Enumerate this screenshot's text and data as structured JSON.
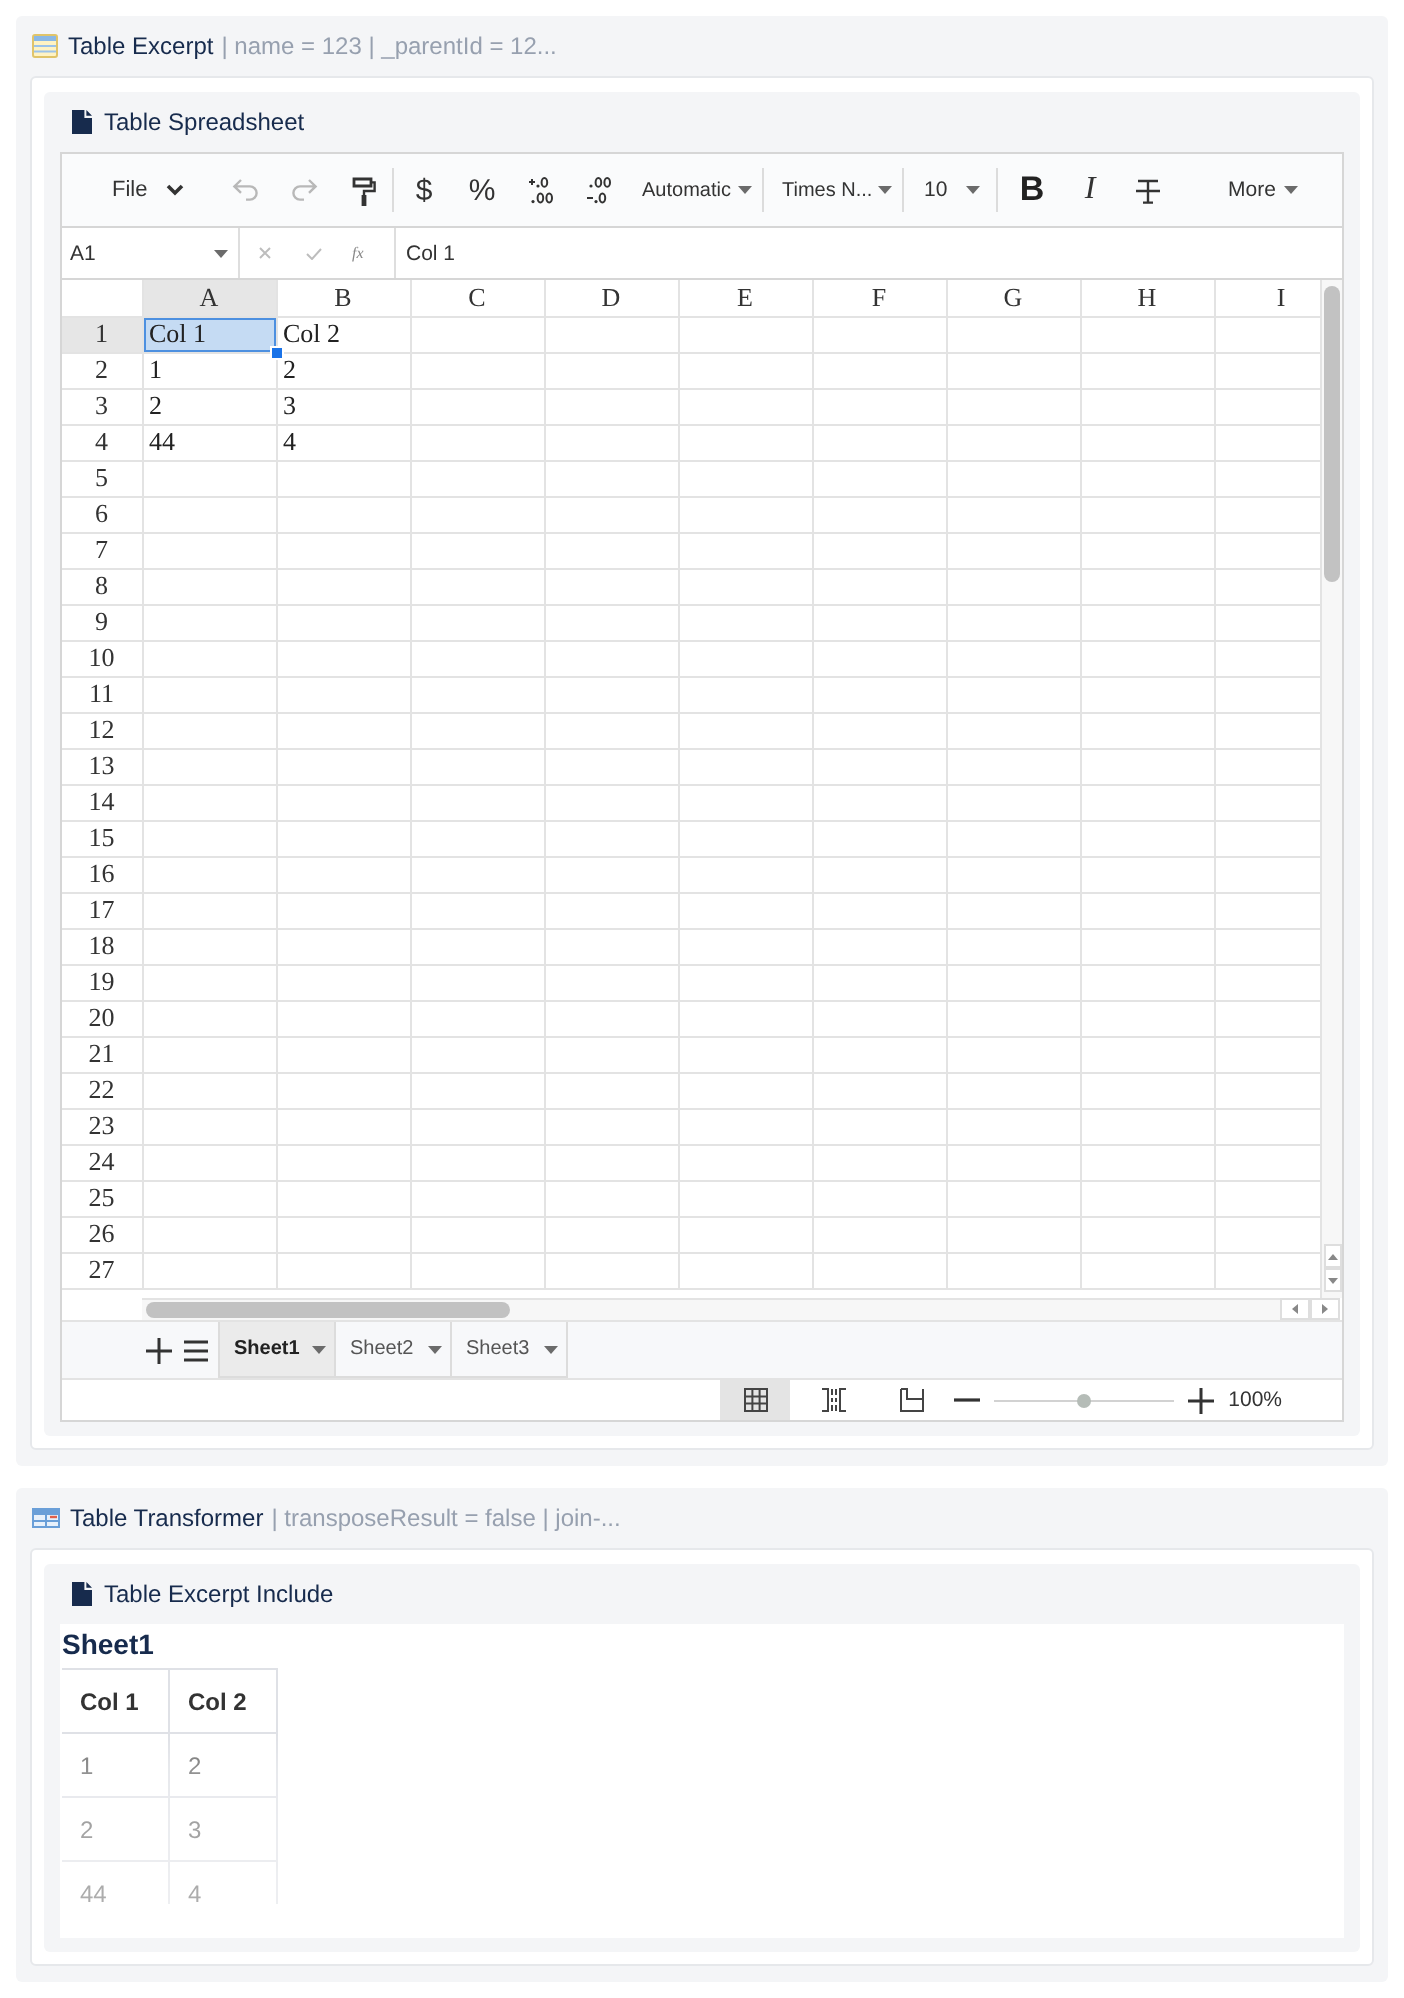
{
  "macros": [
    {
      "kind": "table-excerpt",
      "title": "Table Excerpt",
      "parameters": "| name = 123 | _parentId = 12...",
      "panel": {
        "title": "Table Spreadsheet",
        "spreadsheet": {
          "toolbar": {
            "file_menu": "File",
            "undo": {
              "disabled": true
            },
            "redo": {
              "disabled": true
            },
            "currency": "$",
            "percent": "%",
            "number_format": "Automatic",
            "font_family": "Times N...",
            "font_size": "10",
            "bold": "B",
            "italic": "I",
            "more_menu": "More"
          },
          "formula_bar": {
            "name_box": "A1",
            "function_label": "fx",
            "formula": "Col 1"
          },
          "columns": [
            {
              "label": "A",
              "selected": true
            },
            {
              "label": "B",
              "selected": false
            },
            {
              "label": "C",
              "selected": false
            },
            {
              "label": "D",
              "selected": false
            },
            {
              "label": "E",
              "selected": false
            },
            {
              "label": "F",
              "selected": false
            },
            {
              "label": "G",
              "selected": false
            },
            {
              "label": "H",
              "selected": false
            },
            {
              "label": "I",
              "selected": false
            }
          ],
          "rows": [
            {
              "label": "1",
              "selected": true,
              "cells": [
                {
                  "text": "Col 1",
                  "selected": true
                },
                {
                  "text": "Col 2",
                  "selected": false
                }
              ]
            },
            {
              "label": "2",
              "selected": false,
              "cells": [
                {
                  "text": "1",
                  "selected": false
                },
                {
                  "text": "2",
                  "selected": false
                }
              ]
            },
            {
              "label": "3",
              "selected": false,
              "cells": [
                {
                  "text": "2",
                  "selected": false
                },
                {
                  "text": "3",
                  "selected": false
                }
              ]
            },
            {
              "label": "4",
              "selected": false,
              "cells": [
                {
                  "text": "44",
                  "selected": false
                },
                {
                  "text": "4",
                  "selected": false
                }
              ]
            },
            {
              "label": "5",
              "selected": false
            },
            {
              "label": "6",
              "selected": false
            },
            {
              "label": "7",
              "selected": false
            },
            {
              "label": "8",
              "selected": false
            },
            {
              "label": "9",
              "selected": false
            },
            {
              "label": "10",
              "selected": false
            },
            {
              "label": "11",
              "selected": false
            },
            {
              "label": "12",
              "selected": false
            },
            {
              "label": "13",
              "selected": false
            },
            {
              "label": "14",
              "selected": false
            },
            {
              "label": "15",
              "selected": false
            },
            {
              "label": "16",
              "selected": false
            },
            {
              "label": "17",
              "selected": false
            },
            {
              "label": "18",
              "selected": false
            },
            {
              "label": "19",
              "selected": false
            },
            {
              "label": "20",
              "selected": false
            },
            {
              "label": "21",
              "selected": false
            },
            {
              "label": "22",
              "selected": false
            },
            {
              "label": "23",
              "selected": false
            },
            {
              "label": "24",
              "selected": false
            },
            {
              "label": "25",
              "selected": false
            },
            {
              "label": "26",
              "selected": false
            },
            {
              "label": "27",
              "selected": false
            }
          ],
          "sheet_tabs": [
            {
              "label": "Sheet1",
              "selected": true
            },
            {
              "label": "Sheet2",
              "selected": false
            },
            {
              "label": "Sheet3",
              "selected": false
            }
          ],
          "status_bar": {
            "views": [
              {
                "kind": "normal",
                "selected": true
              },
              {
                "kind": "page-break",
                "selected": false
              },
              {
                "kind": "page-layout",
                "selected": false
              }
            ],
            "zoom": {
              "level": 0.5,
              "reading": "100%"
            }
          }
        }
      }
    },
    {
      "kind": "table-transformer",
      "title": "Table Transformer",
      "parameters": "| transposeResult = false | join-...",
      "panel": {
        "title": "Table Excerpt Include",
        "excerpt": {
          "sheet_title": "Sheet1",
          "columns": [
            "Col 1",
            "Col 2"
          ],
          "rows": [
            [
              "1",
              "2"
            ],
            [
              "2",
              "3"
            ],
            [
              "44",
              "4"
            ]
          ]
        }
      }
    }
  ]
}
